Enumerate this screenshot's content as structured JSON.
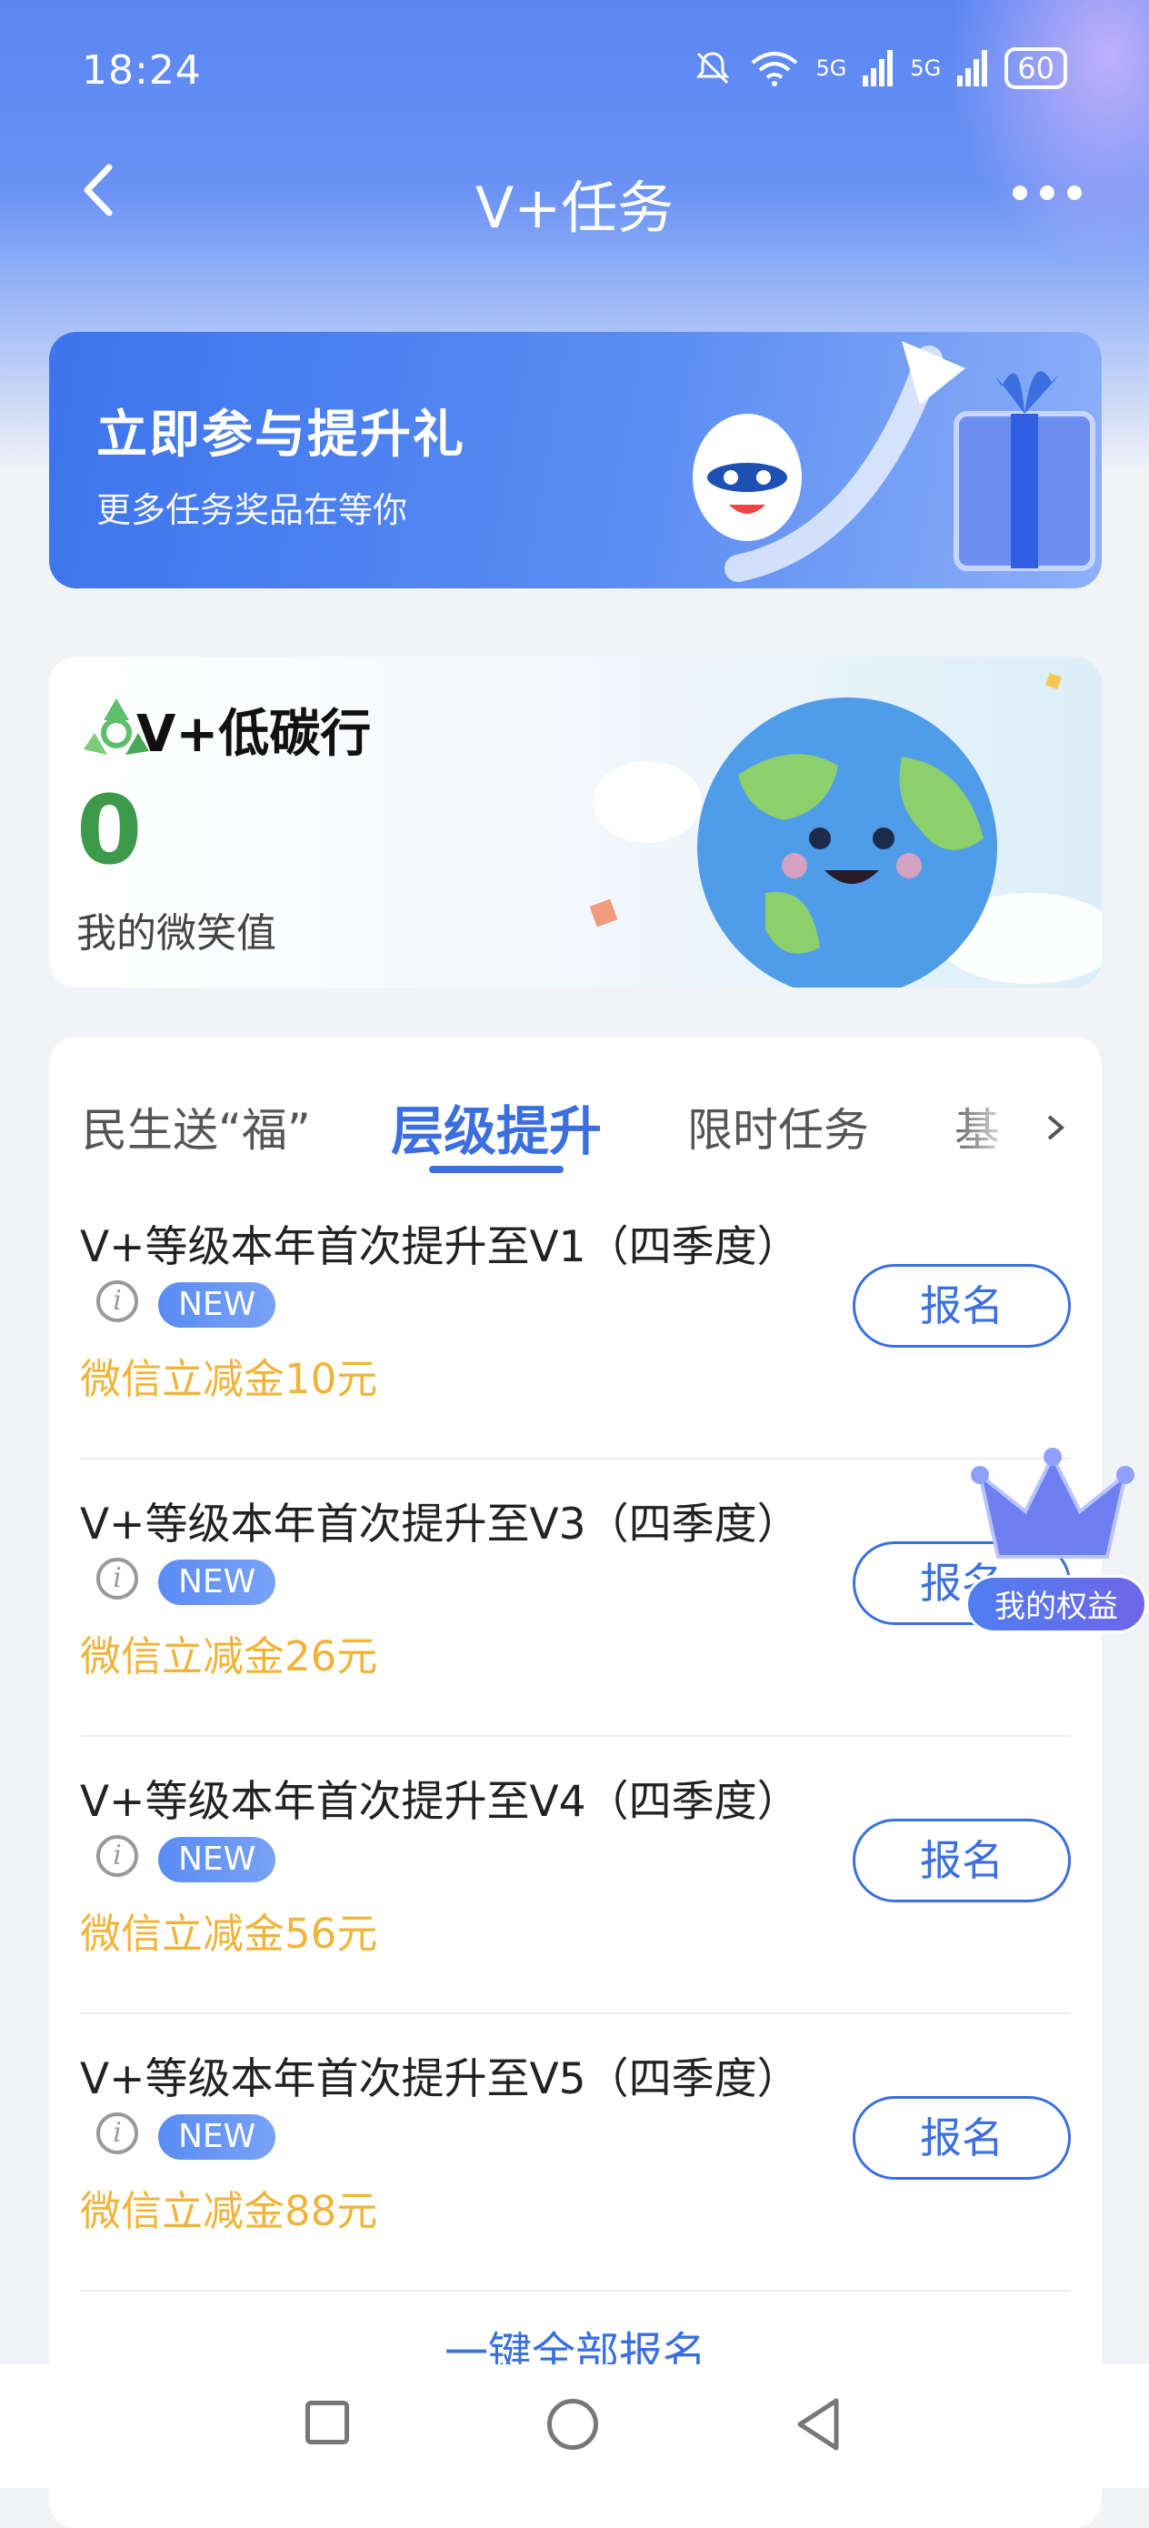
{
  "status_bar": {
    "time": "18:24",
    "signal1": "5G",
    "signal2": "5G",
    "battery": "60"
  },
  "nav": {
    "title": "V+任务"
  },
  "banner": {
    "title": "立即参与提升礼",
    "subtitle": "更多任务奖品在等你"
  },
  "carbon": {
    "title": "V+低碳行",
    "value": "0",
    "label": "我的微笑值"
  },
  "tabs": [
    {
      "label": "民生送“福”"
    },
    {
      "label": "层级提升"
    },
    {
      "label": "限时任务"
    },
    {
      "label": "基"
    }
  ],
  "active_tab": "层级提升",
  "tasks": [
    {
      "name": "V+等级本年首次提升至V1（四季度）",
      "badge": "NEW",
      "reward": "微信立减金10元",
      "button": "报名"
    },
    {
      "name": "V+等级本年首次提升至V3（四季度）",
      "badge": "NEW",
      "reward": "微信立减金26元",
      "button": "报名"
    },
    {
      "name": "V+等级本年首次提升至V4（四季度）",
      "badge": "NEW",
      "reward": "微信立减金56元",
      "button": "报名"
    },
    {
      "name": "V+等级本年首次提升至V5（四季度）",
      "badge": "NEW",
      "reward": "微信立减金88元",
      "button": "报名"
    }
  ],
  "sign_all": "一键全部报名",
  "floating_badge": "我的权益",
  "colors": {
    "primary": "#3b6fe0",
    "reward": "#f0b43a",
    "carbon_value": "#3d9a4a"
  }
}
